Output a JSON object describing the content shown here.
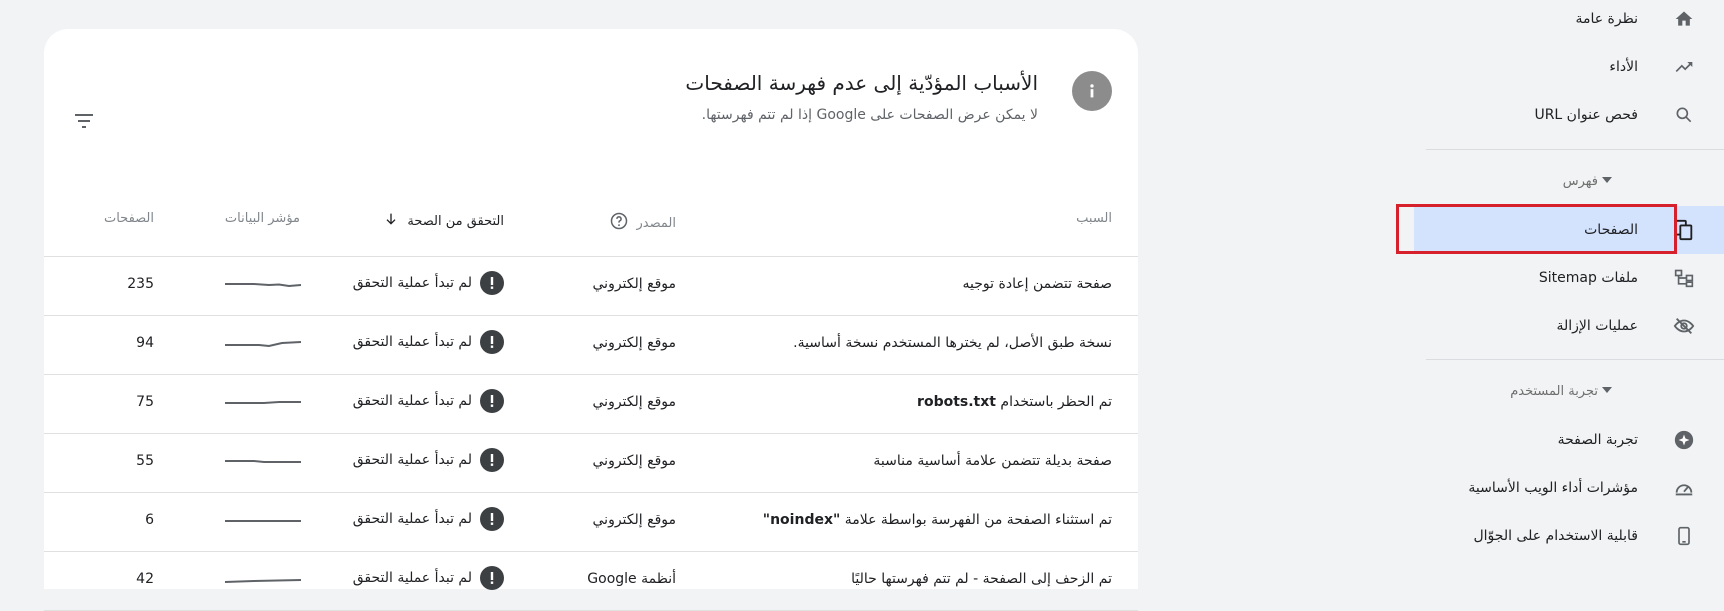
{
  "sidebar": {
    "items_top": [
      {
        "label": "نظرة عامة",
        "icon": "home-icon"
      },
      {
        "label": "الأداء",
        "icon": "trending-up-icon"
      },
      {
        "label": "فحص عنوان URL",
        "icon": "search-icon"
      }
    ],
    "section_index": {
      "label": "فهرس"
    },
    "items_index": [
      {
        "label": "الصفحات",
        "icon": "pages-icon",
        "active": true
      },
      {
        "label": "ملفات Sitemap",
        "icon": "sitemap-icon"
      },
      {
        "label": "عمليات الإزالة",
        "icon": "removals-icon"
      }
    ],
    "section_experience": {
      "label": "تجربة المستخدم"
    },
    "items_experience": [
      {
        "label": "تجربة الصفحة",
        "icon": "page-experience-icon"
      },
      {
        "label": "مؤشرات أداء الويب الأساسية",
        "icon": "speedometer-icon"
      },
      {
        "label": "قابلية الاستخدام على الجوّال",
        "icon": "mobile-icon"
      }
    ]
  },
  "card": {
    "title": "الأسباب المؤدّية إلى عدم فهرسة الصفحات",
    "subtitle": "لا يمكن عرض الصفحات على Google إذا لم تتم فهرستها.",
    "columns": {
      "reason": "السبب",
      "source": "المصدر",
      "validation": "التحقق من الصحة",
      "trend": "مؤشر البيانات",
      "pages": "الصفحات"
    },
    "rows": [
      {
        "reason": "صفحة تتضمن إعادة توجيه",
        "source": "موقع إلكتروني",
        "validation": "لم تبدأ عملية التحقق",
        "pages": "235"
      },
      {
        "reason": "نسخة طبق الأصل، لم يخترها المستخدم نسخة أساسية.",
        "source": "موقع إلكتروني",
        "validation": "لم تبدأ عملية التحقق",
        "pages": "94"
      },
      {
        "reason_prefix": "تم الحظر باستخدام",
        "reason_token": "robots.txt",
        "source": "موقع إلكتروني",
        "validation": "لم تبدأ عملية التحقق",
        "pages": "75"
      },
      {
        "reason": "صفحة بديلة تتضمن علامة أساسية مناسبة",
        "source": "موقع إلكتروني",
        "validation": "لم تبدأ عملية التحقق",
        "pages": "55"
      },
      {
        "reason_prefix": "تم استثناء الصفحة من الفهرسة بواسطة علامة",
        "reason_token": "\"noindex\"",
        "source": "موقع إلكتروني",
        "validation": "لم تبدأ عملية التحقق",
        "pages": "6"
      },
      {
        "reason": "تم الزحف إلى الصفحة - لم تتم فهرستها حاليًا",
        "source": "أنظمة Google",
        "validation": "لم تبدأ عملية التحقق",
        "pages": "42"
      }
    ]
  },
  "colors": {
    "active_bg": "#d3e3fd",
    "highlight": "#d6202b",
    "page_bg": "#f1f3f4"
  }
}
